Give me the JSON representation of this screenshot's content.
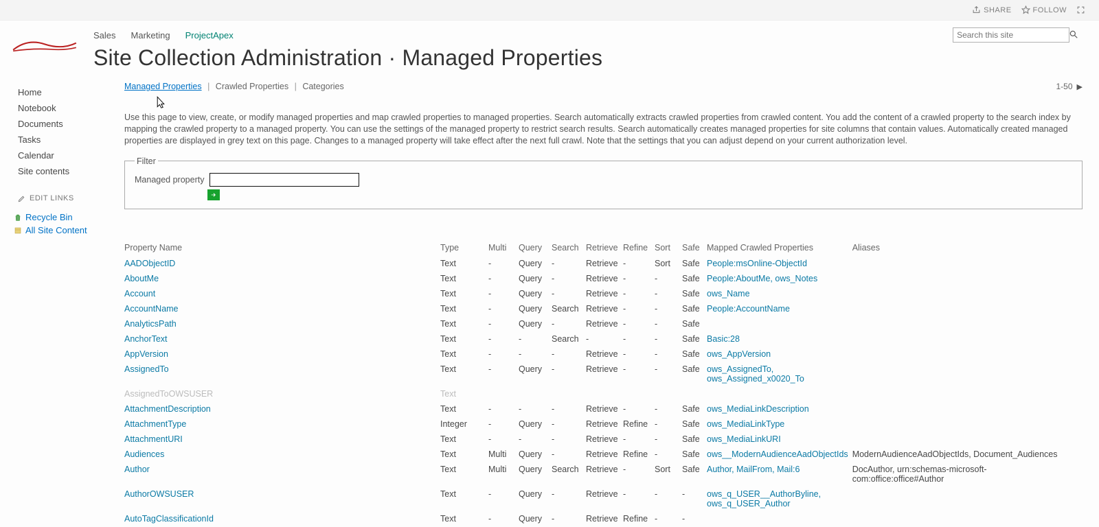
{
  "ribbon": {
    "share": "SHARE",
    "follow": "FOLLOW"
  },
  "topnav": {
    "links": [
      "Sales",
      "Marketing",
      "ProjectApex"
    ],
    "active": 2
  },
  "search": {
    "placeholder": "Search this site"
  },
  "page_title": "Site Collection Administration · Managed Properties",
  "sidebar": {
    "items": [
      "Home",
      "Notebook",
      "Documents",
      "Tasks",
      "Calendar",
      "Site contents"
    ],
    "edit_links": "EDIT LINKS",
    "recycle": "Recycle Bin",
    "all_site": "All Site Content"
  },
  "tabs": {
    "managed": "Managed Properties",
    "crawled": "Crawled Properties",
    "categories": "Categories"
  },
  "pager": {
    "range": "1-50"
  },
  "desc": "Use this page to view, create, or modify managed properties and map crawled properties to managed properties. Search automatically extracts crawled properties from crawled content. You add the content of a crawled property to the search index by mapping the crawled property to a managed property. You can use the settings of the managed property to restrict search results. Search automatically creates managed properties for site columns that contain values. Automatically created managed properties are displayed in grey text on this page. Changes to a managed property will take effect after the next full crawl. Note that the settings that you can adjust depend on your current authorization level.",
  "filter": {
    "legend": "Filter",
    "label": "Managed property"
  },
  "headers": [
    "Property Name",
    "Type",
    "Multi",
    "Query",
    "Search",
    "Retrieve",
    "Refine",
    "Sort",
    "Safe",
    "Mapped Crawled Properties",
    "Aliases"
  ],
  "rows": [
    {
      "name": "AADObjectID",
      "type": "Text",
      "multi": "-",
      "query": "Query",
      "search": "-",
      "retrieve": "Retrieve",
      "refine": "-",
      "sort": "Sort",
      "safe": "Safe",
      "mapped": "People:msOnline-ObjectId",
      "aliases": ""
    },
    {
      "name": "AboutMe",
      "type": "Text",
      "multi": "-",
      "query": "Query",
      "search": "-",
      "retrieve": "Retrieve",
      "refine": "-",
      "sort": "-",
      "safe": "Safe",
      "mapped": "People:AboutMe, ows_Notes",
      "aliases": ""
    },
    {
      "name": "Account",
      "type": "Text",
      "multi": "-",
      "query": "Query",
      "search": "-",
      "retrieve": "Retrieve",
      "refine": "-",
      "sort": "-",
      "safe": "Safe",
      "mapped": "ows_Name",
      "aliases": ""
    },
    {
      "name": "AccountName",
      "type": "Text",
      "multi": "-",
      "query": "Query",
      "search": "Search",
      "retrieve": "Retrieve",
      "refine": "-",
      "sort": "-",
      "safe": "Safe",
      "mapped": "People:AccountName",
      "aliases": ""
    },
    {
      "name": "AnalyticsPath",
      "type": "Text",
      "multi": "-",
      "query": "Query",
      "search": "-",
      "retrieve": "Retrieve",
      "refine": "-",
      "sort": "-",
      "safe": "Safe",
      "mapped": "",
      "aliases": ""
    },
    {
      "name": "AnchorText",
      "type": "Text",
      "multi": "-",
      "query": "-",
      "search": "Search",
      "retrieve": "-",
      "refine": "-",
      "sort": "-",
      "safe": "Safe",
      "mapped": "Basic:28",
      "aliases": ""
    },
    {
      "name": "AppVersion",
      "type": "Text",
      "multi": "-",
      "query": "-",
      "search": "-",
      "retrieve": "Retrieve",
      "refine": "-",
      "sort": "-",
      "safe": "Safe",
      "mapped": "ows_AppVersion",
      "aliases": ""
    },
    {
      "name": "AssignedTo",
      "type": "Text",
      "multi": "-",
      "query": "Query",
      "search": "-",
      "retrieve": "Retrieve",
      "refine": "-",
      "sort": "-",
      "safe": "Safe",
      "mapped": "ows_AssignedTo, ows_Assigned_x0020_To",
      "aliases": ""
    },
    {
      "name": "AssignedToOWSUSER",
      "type": "Text",
      "multi": "",
      "query": "",
      "search": "",
      "retrieve": "",
      "refine": "",
      "sort": "",
      "safe": "",
      "mapped": "",
      "aliases": "",
      "grey": true
    },
    {
      "name": "AttachmentDescription",
      "type": "Text",
      "multi": "-",
      "query": "-",
      "search": "-",
      "retrieve": "Retrieve",
      "refine": "-",
      "sort": "-",
      "safe": "Safe",
      "mapped": "ows_MediaLinkDescription",
      "aliases": ""
    },
    {
      "name": "AttachmentType",
      "type": "Integer",
      "multi": "-",
      "query": "Query",
      "search": "-",
      "retrieve": "Retrieve",
      "refine": "Refine",
      "sort": "-",
      "safe": "Safe",
      "mapped": "ows_MediaLinkType",
      "aliases": ""
    },
    {
      "name": "AttachmentURI",
      "type": "Text",
      "multi": "-",
      "query": "-",
      "search": "-",
      "retrieve": "Retrieve",
      "refine": "-",
      "sort": "-",
      "safe": "Safe",
      "mapped": "ows_MediaLinkURI",
      "aliases": ""
    },
    {
      "name": "Audiences",
      "type": "Text",
      "multi": "Multi",
      "query": "Query",
      "search": "-",
      "retrieve": "Retrieve",
      "refine": "Refine",
      "sort": "-",
      "safe": "Safe",
      "mapped": "ows__ModernAudienceAadObjectIds",
      "aliases": "ModernAudienceAadObjectIds, Document_Audiences"
    },
    {
      "name": "Author",
      "type": "Text",
      "multi": "Multi",
      "query": "Query",
      "search": "Search",
      "retrieve": "Retrieve",
      "refine": "-",
      "sort": "Sort",
      "safe": "Safe",
      "mapped": "Author, MailFrom, Mail:6",
      "aliases": "DocAuthor, urn:schemas-microsoft-com:office:office#Author"
    },
    {
      "name": "AuthorOWSUSER",
      "type": "Text",
      "multi": "-",
      "query": "Query",
      "search": "-",
      "retrieve": "Retrieve",
      "refine": "-",
      "sort": "-",
      "safe": "-",
      "mapped": "ows_q_USER__AuthorByline, ows_q_USER_Author",
      "aliases": ""
    },
    {
      "name": "AutoTagClassificationId",
      "type": "Text",
      "multi": "-",
      "query": "Query",
      "search": "-",
      "retrieve": "Retrieve",
      "refine": "Refine",
      "sort": "-",
      "safe": "-",
      "mapped": "",
      "aliases": ""
    }
  ]
}
